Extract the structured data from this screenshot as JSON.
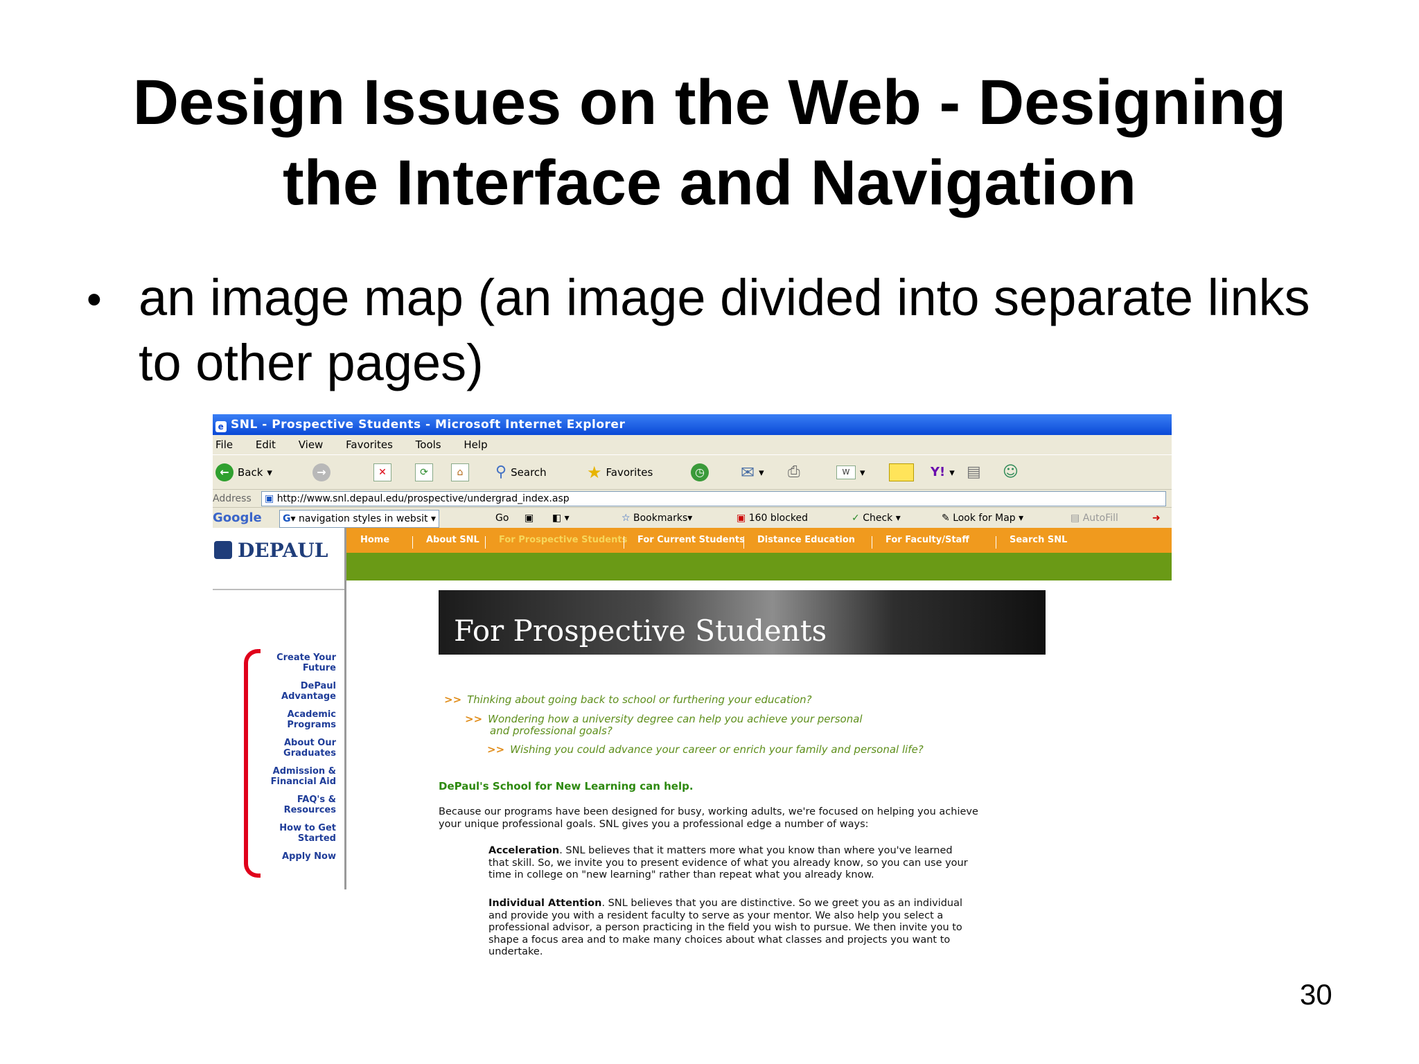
{
  "slide": {
    "title_line1": "Design Issues on the Web - Designing",
    "title_line2": "the Interface and Navigation",
    "bullet": "an image map (an image divided into separate links to other pages)",
    "page_number": "30"
  },
  "browser": {
    "window_title": "SNL - Prospective Students - Microsoft Internet Explorer",
    "menu": [
      "File",
      "Edit",
      "View",
      "Favorites",
      "Tools",
      "Help"
    ],
    "toolbar": {
      "back_label": "Back",
      "search_label": "Search",
      "favorites_label": "Favorites"
    },
    "address_label": "Address",
    "address_value": "http://www.snl.depaul.edu/prospective/undergrad_index.asp",
    "google": {
      "logo": "Google",
      "search_value": "navigation styles in websit",
      "go_label": "Go",
      "bookmarks_label": "Bookmarks",
      "blocked_label": "160 blocked",
      "check_label": "Check",
      "lookfor_label": "Look for Map",
      "autofill_label": "AutoFill"
    }
  },
  "page": {
    "logo_text": "DEPAUL",
    "nav": [
      "Home",
      "About SNL",
      "For Prospective Students",
      "For Current Students",
      "Distance Education",
      "For Faculty/Staff",
      "Search SNL"
    ],
    "hero_text": "For Prospective Students",
    "side_links": [
      [
        "Create Your",
        "Future"
      ],
      [
        "DePaul",
        "Advantage"
      ],
      [
        "Academic",
        "Programs"
      ],
      [
        "About Our",
        "Graduates"
      ],
      [
        "Admission &",
        "Financial Aid"
      ],
      [
        "FAQ's &",
        "Resources"
      ],
      [
        "How to Get",
        "Started"
      ],
      [
        "Apply Now",
        ""
      ]
    ],
    "questions": {
      "arrow": ">>",
      "q1": "Thinking about going back to school or furthering your education?",
      "q2a": "Wondering how a university degree can help you achieve your personal",
      "q2b": "and professional goals?",
      "q3": "Wishing you could advance your career or enrich your family and personal life?"
    },
    "lead": "DePaul's School for New Learning can help.",
    "intro_line1": "Because our programs have been designed for busy, working adults, we're focused on helping you achieve",
    "intro_line2": "your unique professional goals. SNL gives you a professional edge a number of ways:",
    "acc_head": "Acceleration",
    "acc_line1": ". SNL believes that it matters more what you know than where you've learned",
    "acc_line2": "that skill. So, we invite you to present evidence of what you already know, so you can use your",
    "acc_line3": "time in college on \"new learning\" rather than repeat what you already know.",
    "ind_head": "Individual Attention",
    "ind_line1": ". SNL believes that you are distinctive. So we greet you as an individual",
    "ind_line2": "and provide you with a resident faculty to serve as your mentor. We also help you select a",
    "ind_line3": "professional advisor, a person practicing in the field you wish to pursue. We then invite you to",
    "ind_line4": "shape a focus area and to make many choices about what classes and projects you want to",
    "ind_line5": "undertake."
  }
}
